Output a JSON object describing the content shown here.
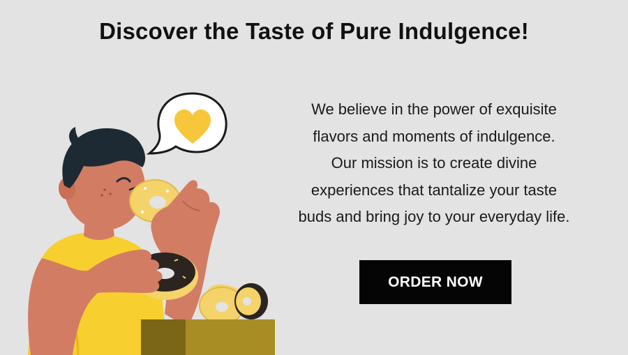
{
  "hero": {
    "title": "Discover the Taste of Pure Indulgence!",
    "mission_lines": [
      "We believe in the power of exquisite",
      "flavors and moments of indulgence.",
      "Our mission is to create divine",
      "experiences that tantalize your taste",
      "buds and bring joy to your everyday life."
    ],
    "cta_label": "ORDER NOW"
  },
  "illustration": {
    "speech_bubble_icon": "heart-icon",
    "subject": "person-eating-donuts"
  },
  "colors": {
    "background": "#e3e3e3",
    "button_background": "#050505",
    "button_text": "#ffffff",
    "skin": "#d27c64",
    "shirt": "#f7cf2f",
    "hair": "#1e2a33",
    "heart": "#f8c63a",
    "box_light": "#a88d24",
    "box_dark": "#7b6618",
    "donut_dough": "#f4d36b",
    "donut_chocolate": "#2b2420"
  }
}
